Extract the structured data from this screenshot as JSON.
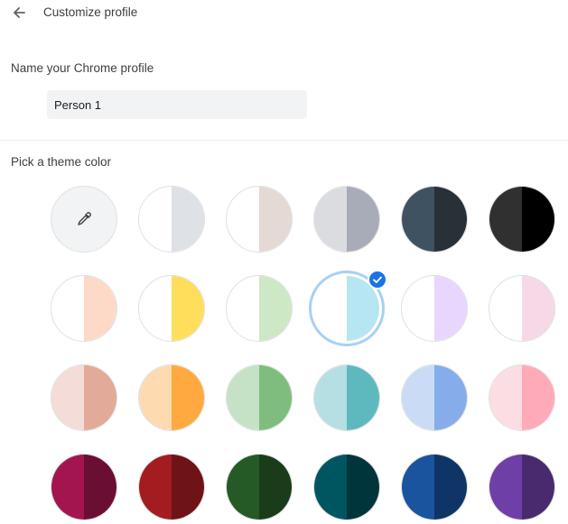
{
  "header": {
    "title": "Customize profile",
    "back_icon": "arrow-left-icon"
  },
  "name_section": {
    "label": "Name your Chrome profile",
    "input_value": "Person 1"
  },
  "theme_section": {
    "label": "Pick a theme color",
    "custom_picker_icon": "eyedropper-icon",
    "selected_icon": "check-icon",
    "swatches": [
      [
        {
          "id": "custom",
          "left": "#f1f3f4",
          "right": "#f1f3f4",
          "custom": true
        },
        {
          "id": "grey-light",
          "left": "#ffffff",
          "right": "#dee1e6"
        },
        {
          "id": "warm-grey",
          "left": "#ffffff",
          "right": "#e5d9d6"
        },
        {
          "id": "cool-grey",
          "left": "#dadce0",
          "right": "#a8abb8"
        },
        {
          "id": "slate",
          "left": "#3f5261",
          "right": "#283038"
        },
        {
          "id": "black",
          "left": "#303030",
          "right": "#000000"
        }
      ],
      [
        {
          "id": "peach",
          "left": "#ffffff",
          "right": "#fddac8"
        },
        {
          "id": "yellow",
          "left": "#ffffff",
          "right": "#ffde5c"
        },
        {
          "id": "light-green",
          "left": "#ffffff",
          "right": "#cde8c4"
        },
        {
          "id": "light-cyan",
          "left": "#ffffff",
          "right": "#b5e6f1",
          "selected": true
        },
        {
          "id": "lavender",
          "left": "#ffffff",
          "right": "#e8d6fe"
        },
        {
          "id": "light-pink",
          "left": "#ffffff",
          "right": "#f7d8e7"
        }
      ],
      [
        {
          "id": "rose",
          "left": "#f4ddd8",
          "right": "#e2aa98"
        },
        {
          "id": "orange",
          "left": "#fedab0",
          "right": "#ffa940"
        },
        {
          "id": "green",
          "left": "#c5e2c6",
          "right": "#7ebd7e"
        },
        {
          "id": "teal",
          "left": "#b5dfe2",
          "right": "#5eb9bf"
        },
        {
          "id": "blue",
          "left": "#cadcf5",
          "right": "#86adea"
        },
        {
          "id": "pink",
          "left": "#fcdde3",
          "right": "#ffaab8"
        }
      ],
      [
        {
          "id": "magenta",
          "left": "#a3154e",
          "right": "#6a0e34"
        },
        {
          "id": "red",
          "left": "#a31c1f",
          "right": "#6e1416"
        },
        {
          "id": "forest",
          "left": "#255a26",
          "right": "#1a3c1a"
        },
        {
          "id": "dark-teal",
          "left": "#005660",
          "right": "#00363b"
        },
        {
          "id": "navy",
          "left": "#1a549e",
          "right": "#0e3566"
        },
        {
          "id": "purple",
          "left": "#6f3fa8",
          "right": "#492a6e"
        }
      ]
    ]
  }
}
